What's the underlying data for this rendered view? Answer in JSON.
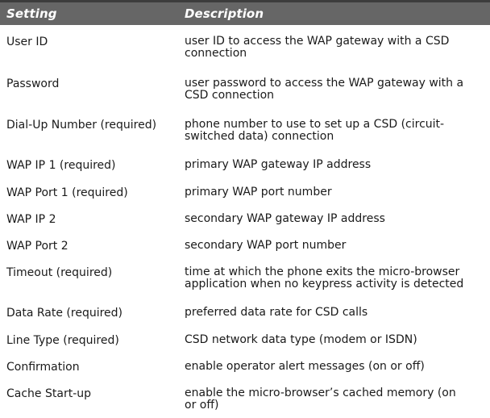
{
  "table": {
    "header": {
      "setting": "Setting",
      "description": "Description"
    },
    "rows": [
      {
        "setting": "User ID",
        "description": "user ID to access the WAP gateway with a CSD connection"
      },
      {
        "setting": "Password",
        "description": "user password to access the WAP gateway with a CSD connection"
      },
      {
        "setting": "Dial-Up Number (required)",
        "description": "phone number to use to set up a CSD (circuit-switched data) connection"
      },
      {
        "setting": "WAP IP 1 (required)",
        "description": "primary WAP gateway IP address"
      },
      {
        "setting": "WAP Port 1 (required)",
        "description": "primary WAP port number"
      },
      {
        "setting": "WAP IP 2",
        "description": "secondary WAP gateway IP address"
      },
      {
        "setting": "WAP Port 2",
        "description": "secondary WAP port number"
      },
      {
        "setting": "Timeout (required)",
        "description": "time at which the phone exits the micro-browser application when no keypress activity is detected"
      },
      {
        "setting": "Data Rate (required)",
        "description": "preferred data rate for CSD calls"
      },
      {
        "setting": "Line Type (required)",
        "description": "CSD network data type (modem or ISDN)"
      },
      {
        "setting": "Confirmation",
        "description": "enable operator alert messages (on or off)"
      },
      {
        "setting": "Cache Start-up",
        "description": "enable the micro-browser’s cached memory (on or off)"
      }
    ]
  }
}
